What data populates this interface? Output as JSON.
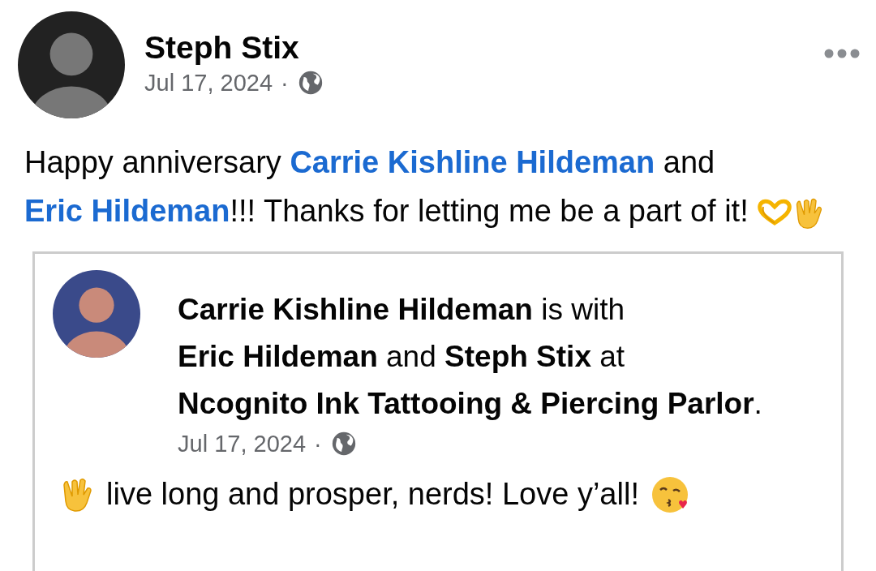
{
  "post": {
    "author": "Steph Stix",
    "date": "Jul 17, 2024",
    "separator": "·",
    "text": "Happy anniversary **Carrie Kishline Hildeman** and **Eric Hildeman**!!! Thanks for letting me be a part of it!"
  },
  "shared": {
    "headline": "**Carrie Kishline Hildeman** is with **Eric Hildeman** and **Steph Stix** at **Ncognito Ink Tattooing & Piercing Parlor**.",
    "date": "Jul 17, 2024",
    "separator": "·",
    "text": "live long and prosper, nerds! Love y’all!"
  }
}
